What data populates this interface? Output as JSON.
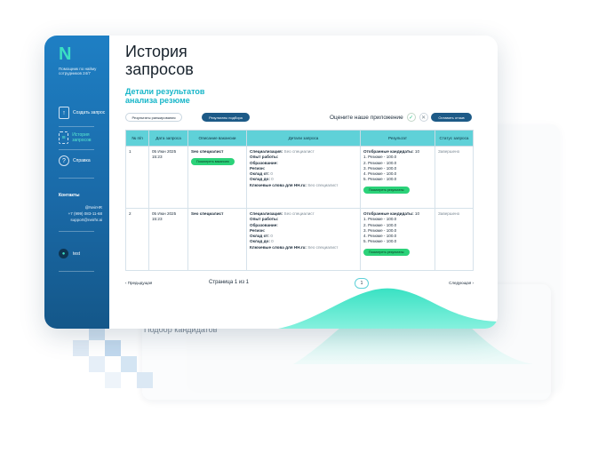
{
  "app": {
    "logo": "N",
    "tagline": "Помощник по найму сотрудников 24/7",
    "page_title": "История запросов",
    "subtitle": "Детали результатов анализа резюме"
  },
  "sidebar": {
    "items": [
      {
        "label": "Создать запрос",
        "icon": "upload-icon"
      },
      {
        "label": "История запросов",
        "icon": "list-icon"
      },
      {
        "label": "Справка",
        "icon": "help-icon"
      }
    ],
    "contacts_title": "Контакты",
    "contacts": [
      "@NeirHR",
      "+7 (999) 083-11-68",
      "support@neirhr.ai"
    ],
    "user": "test"
  },
  "tabs": [
    "Результаты ранжирования",
    "Результаты подбора"
  ],
  "rating": {
    "label": "Оцените наше приложение",
    "button": "Оставить отзыв"
  },
  "table": {
    "headers": [
      "№ п/п",
      "Дата запроса",
      "Описание вакансии",
      "Детали запроса",
      "Результат",
      "Статус запроса"
    ],
    "rows": [
      {
        "num": "1",
        "date": "05 Июн 2025 15:23",
        "vacancy": "Seo специалист",
        "vacancy_button": "Посмотреть вакансию",
        "details": [
          {
            "k": "Специализация:",
            "v": "Seo специалист"
          },
          {
            "k": "Опыт работы:",
            "v": ""
          },
          {
            "k": "Образование:",
            "v": ""
          },
          {
            "k": "Регион:",
            "v": ""
          },
          {
            "k": "Оклад от:",
            "v": "0"
          },
          {
            "k": "Оклад до:",
            "v": "0"
          },
          {
            "k": "Ключевые слова для HH.ru:",
            "v": "Seo специалист"
          }
        ],
        "result_title": "Отобранные кандидаты:",
        "result_count": "10",
        "resumes": [
          "1. Резюме - 100.0",
          "2. Резюме - 100.0",
          "3. Резюме - 100.0",
          "4. Резюме - 100.0",
          "5. Резюме - 100.0"
        ],
        "result_button": "Посмотреть результаты",
        "status": "Завершено"
      },
      {
        "num": "2",
        "date": "05 Июн 2025 15:23",
        "vacancy": "Seo специалист",
        "vacancy_button": "",
        "details": [
          {
            "k": "Специализация:",
            "v": "Seo специалист"
          },
          {
            "k": "Опыт работы:",
            "v": ""
          },
          {
            "k": "Образование:",
            "v": ""
          },
          {
            "k": "Регион:",
            "v": ""
          },
          {
            "k": "Оклад от:",
            "v": "0"
          },
          {
            "k": "Оклад до:",
            "v": "0"
          },
          {
            "k": "Ключевые слова для HH.ru:",
            "v": "Seo специалист"
          }
        ],
        "result_title": "Отобранные кандидаты:",
        "result_count": "10",
        "resumes": [
          "1. Резюме - 100.0",
          "2. Резюме - 100.0",
          "3. Резюме - 100.0",
          "4. Резюме - 100.0",
          "5. Резюме - 100.0"
        ],
        "result_button": "Посмотреть результаты",
        "status": "Завершено"
      }
    ]
  },
  "pager": {
    "prev": "Предыдущая",
    "info": "Страница 1 из 1",
    "current": "1",
    "next": "Следующая"
  },
  "background": {
    "text1": "Подбор кандидатов"
  },
  "colors": {
    "accent": "#5fd1d8",
    "sidebar": "#1e7fc4",
    "button": "#2bd279"
  }
}
